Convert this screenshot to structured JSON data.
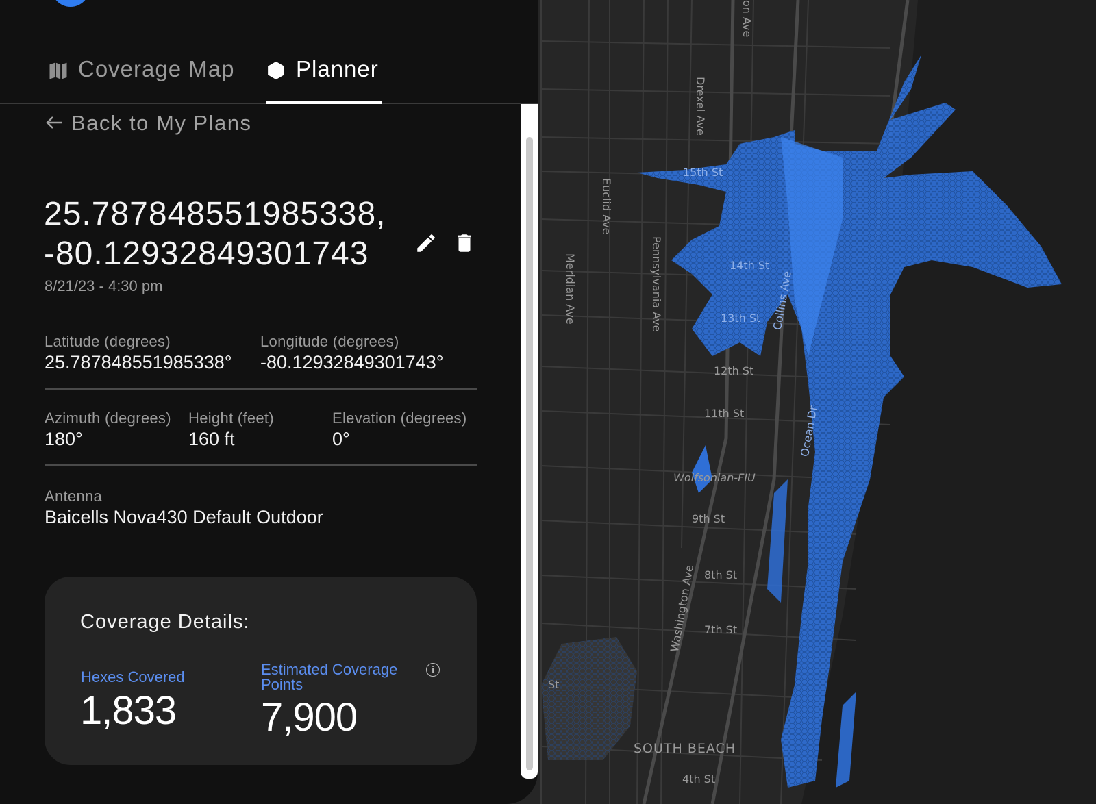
{
  "tabs": [
    {
      "label": "Coverage Map",
      "icon": "map-icon",
      "active": false
    },
    {
      "label": "Planner",
      "icon": "hexagon-icon",
      "active": true
    }
  ],
  "back_link": {
    "label": "Back to My Plans",
    "icon": "arrow-left-icon"
  },
  "plan": {
    "title_line1": "25.787848551985338,",
    "title_line2": "-80.12932849301743",
    "date": "8/21/23 - 4:30 pm",
    "edit_icon": "pencil-icon",
    "delete_icon": "trash-icon"
  },
  "fields": {
    "latitude": {
      "label": "Latitude (degrees)",
      "value": "25.787848551985338°"
    },
    "longitude": {
      "label": "Longitude (degrees)",
      "value": "-80.12932849301743°"
    },
    "azimuth": {
      "label": "Azimuth (degrees)",
      "value": "180°"
    },
    "height": {
      "label": "Height (feet)",
      "value": "160 ft"
    },
    "elevation": {
      "label": "Elevation (degrees)",
      "value": "0°"
    },
    "antenna": {
      "label": "Antenna",
      "value": "Baicells Nova430 Default Outdoor"
    }
  },
  "coverage": {
    "title": "Coverage Details:",
    "hexes_label": "Hexes Covered",
    "hexes_value": "1,833",
    "points_label_line1": "Estimated Coverage",
    "points_label_line2": "Points",
    "points_value": "7,900",
    "info_icon": "info-icon"
  },
  "map": {
    "streets": {
      "s15": "15th St",
      "s14": "14th St",
      "s13": "13th St",
      "s12": "12th St",
      "s11": "11th St",
      "s9": "9th St",
      "s8": "8th St",
      "s7": "7th St",
      "s4": "4th St",
      "drexel": "Drexel Ave",
      "euclid": "Euclid Ave",
      "penn": "Pennsylvania Ave",
      "meridian": "Meridian Ave",
      "collins": "Collins Ave",
      "ocean": "Ocean Dr",
      "washington": "Washington Ave",
      "on_ave": "on Ave",
      "st": "St"
    },
    "poi": "Wolfsonian-FIU",
    "neighborhood": "SOUTH BEACH",
    "colors": {
      "coverage": "#2f6fd6",
      "coverage_bright": "#3d85f0",
      "water": "#1c1c1c",
      "land": "#262626"
    }
  }
}
